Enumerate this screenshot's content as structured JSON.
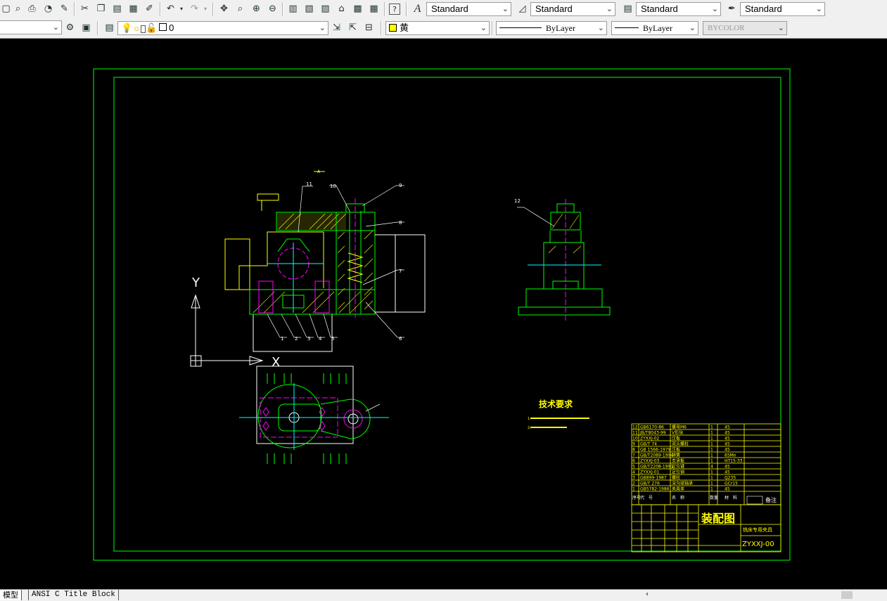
{
  "toolbar1": {
    "text_style": "Standard",
    "dim_style": "Standard",
    "table_style": "Standard",
    "mleader_style": "Standard"
  },
  "toolbar2": {
    "workspace": "",
    "layer": "0",
    "color": "黄",
    "linetype": "ByLayer",
    "lineweight": "ByLayer",
    "plotstyle": "BYCOLOR"
  },
  "drawing": {
    "ucs_x": "X",
    "ucs_y": "Y",
    "tech_title": "技术要求",
    "tech_line1": "1.",
    "tech_line2": "2.",
    "title_main": "装配图",
    "title_sub": "铣床专用夹具",
    "drawing_no": "ZYXXJ-00",
    "remark_label": "备注",
    "datum_label": "A",
    "balloons": [
      "1",
      "2",
      "3",
      "4",
      "5",
      "6",
      "7",
      "8",
      "9",
      "10",
      "11",
      "12"
    ],
    "bom_headers": [
      "序号",
      "代　号",
      "名　称",
      "数量",
      "材　料",
      "备注"
    ],
    "bom_rows": [
      {
        "no": "12",
        "code": "GB6170-86",
        "name": "螺母M6",
        "qty": "1",
        "mat": "45"
      },
      {
        "no": "11",
        "code": "JB/T8043-99",
        "name": "V形块",
        "qty": "1",
        "mat": "45"
      },
      {
        "no": "10",
        "code": "ZYXXJ-02",
        "name": "压板",
        "qty": "1",
        "mat": "45"
      },
      {
        "no": "9",
        "code": "GB/T 74",
        "name": "双头螺柱",
        "qty": "1",
        "mat": "45"
      },
      {
        "no": "8",
        "code": "GB 1566-1979",
        "name": "压板",
        "qty": "1",
        "mat": "45"
      },
      {
        "no": "7",
        "code": "GB/T2089-1994",
        "name": "弹簧",
        "qty": "1",
        "mat": "65Mn"
      },
      {
        "no": "6",
        "code": "ZYXXJ-03",
        "name": "支承板",
        "qty": "1",
        "mat": "HT15-33"
      },
      {
        "no": "5",
        "code": "GB/T2208-1991",
        "name": "定位键",
        "qty": "4",
        "mat": "45"
      },
      {
        "no": "4",
        "code": "ZYXXJ-01",
        "name": "定位销",
        "qty": "1",
        "mat": "45"
      },
      {
        "no": "3",
        "code": "GB899-1987",
        "name": "螺柱",
        "qty": "1",
        "mat": "Q235"
      },
      {
        "no": "2",
        "code": "GB/T 276",
        "name": "深沟球轴承",
        "qty": "1",
        "mat": "GCr15"
      },
      {
        "no": "1",
        "code": "GB5782-1986",
        "name": "夹具体",
        "qty": "1",
        "mat": "45"
      }
    ]
  },
  "tabs": {
    "model": "模型",
    "layout1": "ANSI C Title Block"
  },
  "colors": {
    "border": "#00ff00",
    "yellow": "#ffff00",
    "magenta": "#ff00ff",
    "cyan": "#00ffff",
    "white": "#ffffff",
    "green": "#00ff00"
  }
}
